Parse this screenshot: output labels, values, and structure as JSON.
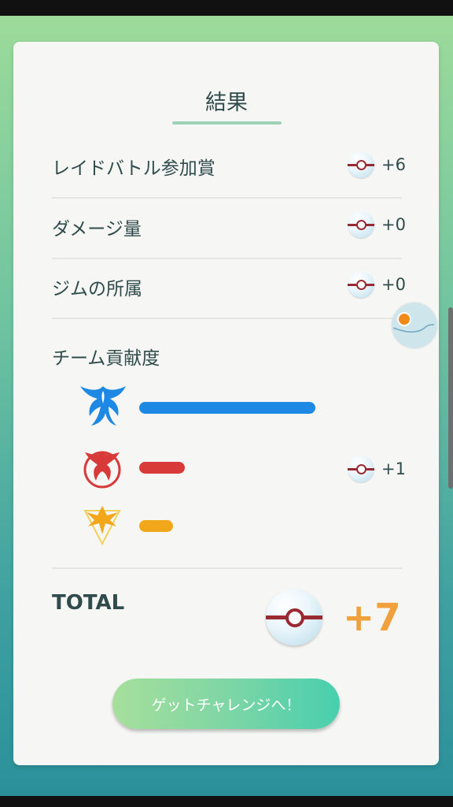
{
  "result": {
    "title": "結果",
    "rows": [
      {
        "label": "レイドバトル参加賞",
        "reward": "+6"
      },
      {
        "label": "ダメージ量",
        "reward": "+0"
      },
      {
        "label": "ジムの所属",
        "reward": "+0"
      }
    ],
    "team_section": {
      "label": "チーム貢献度",
      "teams": [
        {
          "name": "mystic",
          "color": "#1e88e5",
          "contribution_pct": 100,
          "reward": ""
        },
        {
          "name": "valor",
          "color": "#d83a3a",
          "contribution_pct": 26,
          "reward": "+1"
        },
        {
          "name": "instinct",
          "color": "#f2a71b",
          "contribution_pct": 19,
          "reward": ""
        }
      ]
    },
    "total": {
      "label": "TOTAL",
      "value": "+7"
    },
    "cta_label": "ゲットチャレンジへ！"
  },
  "colors": {
    "accent_green": "#9fd1b7",
    "total_value": "#f0a13e",
    "text": "#2f4b4b"
  },
  "icons": {
    "reward_item": "premier-ball-icon",
    "mystic": "articuno-icon",
    "valor": "moltres-icon",
    "instinct": "zapdos-icon"
  }
}
